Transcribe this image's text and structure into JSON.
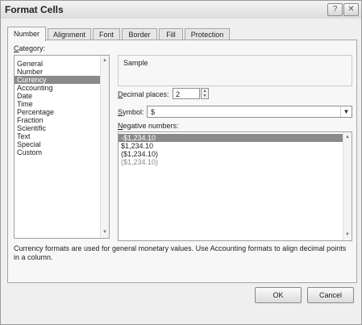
{
  "dialog": {
    "title": "Format Cells",
    "help_glyph": "?",
    "close_glyph": "✕"
  },
  "tabs": [
    {
      "label": "Number"
    },
    {
      "label": "Alignment"
    },
    {
      "label": "Font"
    },
    {
      "label": "Border"
    },
    {
      "label": "Fill"
    },
    {
      "label": "Protection"
    }
  ],
  "category": {
    "label_underline": "C",
    "label_rest": "ategory:",
    "items": [
      "General",
      "Number",
      "Currency",
      "Accounting",
      "Date",
      "Time",
      "Percentage",
      "Fraction",
      "Scientific",
      "Text",
      "Special",
      "Custom"
    ],
    "selected": "Currency"
  },
  "sample": {
    "label": "Sample",
    "value": ""
  },
  "decimal_places": {
    "label_underline": "D",
    "label_rest": "ecimal places:",
    "value": "2"
  },
  "symbol": {
    "label_underline": "S",
    "label_rest": "ymbol:",
    "value": "$"
  },
  "negative_numbers": {
    "label_underline": "N",
    "label_rest": "egative numbers:",
    "items": [
      "-$1,234.10",
      "$1,234.10",
      "($1,234.10)",
      "($1,234.10)"
    ],
    "selected": "-$1,234.10"
  },
  "description": "Currency formats are used for general monetary values.  Use Accounting formats to align decimal points in a column.",
  "buttons": {
    "ok": "OK",
    "cancel": "Cancel"
  },
  "icons": {
    "scroll_up": "▲",
    "scroll_down": "▼",
    "dropdown": "▼",
    "spin_up": "▲",
    "spin_down": "▼"
  }
}
